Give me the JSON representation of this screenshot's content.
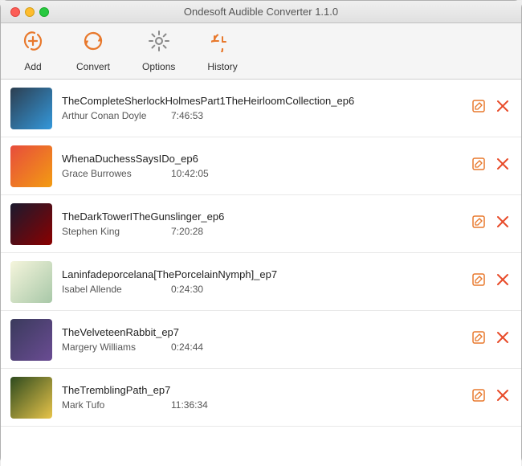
{
  "window": {
    "title": "Ondesoft Audible Converter 1.1.0"
  },
  "toolbar": {
    "add_label": "Add",
    "convert_label": "Convert",
    "options_label": "Options",
    "history_label": "History"
  },
  "books": [
    {
      "id": 1,
      "title": "TheCompleteSherlockHolmesPart1TheHeirloomCollection_ep6",
      "author": "Arthur Conan Doyle",
      "duration": "7:46:53",
      "cover_class": "book-cover-1"
    },
    {
      "id": 2,
      "title": "WhenaDuchessSaysIDo_ep6",
      "author": "Grace Burrowes",
      "duration": "10:42:05",
      "cover_class": "book-cover-2"
    },
    {
      "id": 3,
      "title": "TheDarkTowerITheGunslinger_ep6",
      "author": "Stephen King",
      "duration": "7:20:28",
      "cover_class": "book-cover-3"
    },
    {
      "id": 4,
      "title": "Laninfadeporcelana[ThePorcelainNymph]_ep7",
      "author": "Isabel Allende",
      "duration": "0:24:30",
      "cover_class": "book-cover-4"
    },
    {
      "id": 5,
      "title": "TheVelveteenRabbit_ep7",
      "author": "Margery Williams",
      "duration": "0:24:44",
      "cover_class": "book-cover-5"
    },
    {
      "id": 6,
      "title": "TheTremblingPath_ep7",
      "author": "Mark Tufo",
      "duration": "11:36:34",
      "cover_class": "book-cover-6"
    }
  ]
}
